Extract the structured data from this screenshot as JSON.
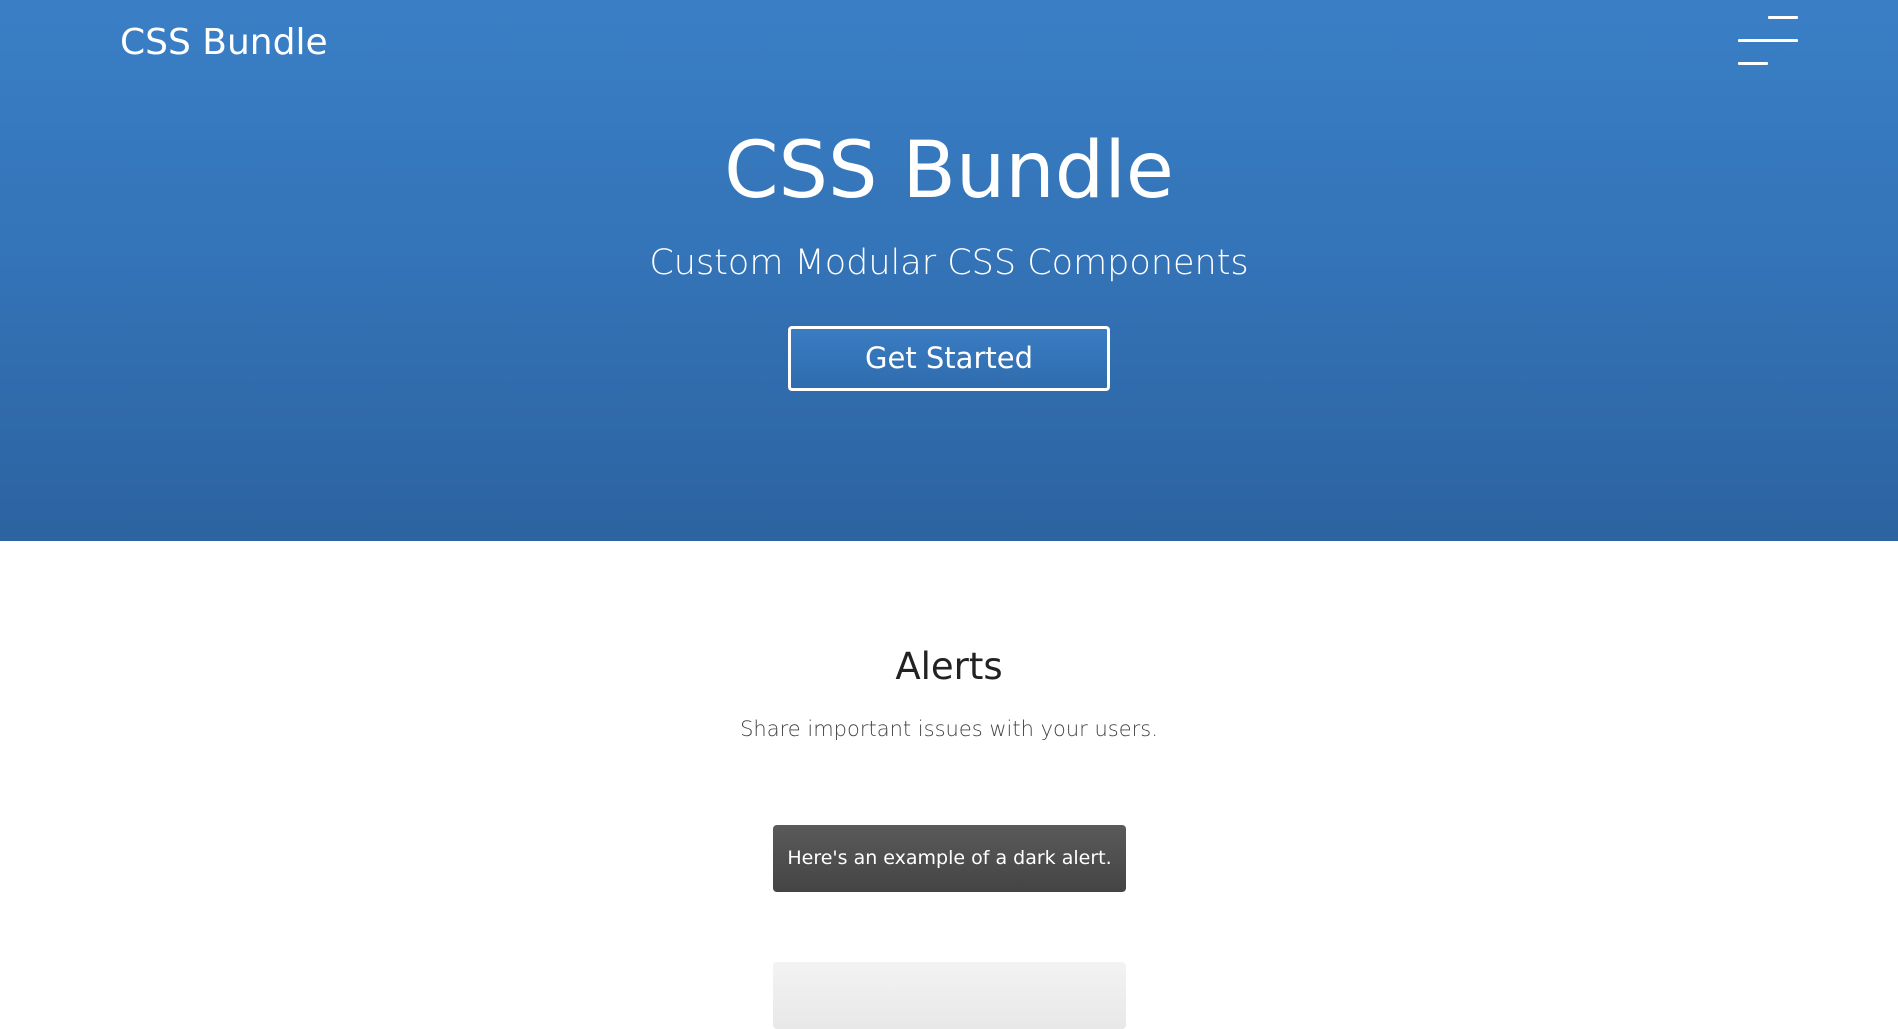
{
  "header": {
    "brand": "CSS Bundle",
    "menu_icon": "hamburger-menu-icon"
  },
  "hero": {
    "title": "CSS Bundle",
    "subtitle": "Custom Modular CSS Components",
    "cta_label": "Get Started"
  },
  "alerts_section": {
    "title": "Alerts",
    "description": "Share important issues with your users.",
    "dark_alert_text": "Here's an example of a dark alert.",
    "light_alert_text": ""
  },
  "colors": {
    "hero_top": "#3a7fc6",
    "hero_bottom": "#2c63a1",
    "dark_alert": "#4e4e4e",
    "light_alert": "#ececec"
  }
}
